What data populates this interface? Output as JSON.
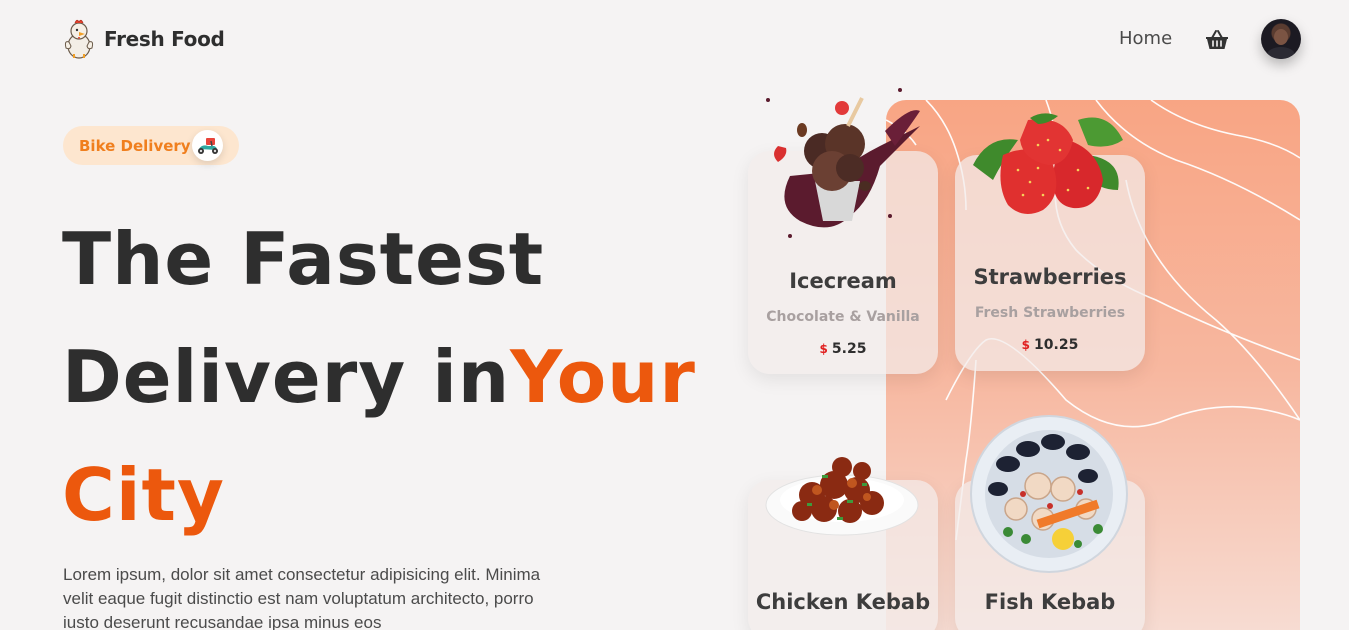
{
  "header": {
    "brand_name": "Fresh Food",
    "nav": {
      "home_label": "Home"
    },
    "icons": {
      "logo": "chicken-logo-icon",
      "cart": "basket-icon",
      "avatar": "user-avatar"
    }
  },
  "hero": {
    "badge_label": "Bike Delivery",
    "badge_icon": "scooter-icon",
    "headline_line1": "The Fastest",
    "headline_line2_plain": "Delivery in",
    "headline_line2_accent": "Your",
    "headline_line3_accent": "City",
    "description": "Lorem ipsum, dolor sit amet consectetur adipisicing elit. Minima velit eaque fugit distinctio est nam voluptatum architecto, porro iusto deserunt recusandae ipsa minus eos"
  },
  "cards": [
    {
      "title": "Icecream",
      "subtitle": "Chocolate & Vanilla",
      "currency": "$",
      "price": "5.25",
      "image": "icecream"
    },
    {
      "title": "Strawberries",
      "subtitle": "Fresh Strawberries",
      "currency": "$",
      "price": "10.25",
      "image": "strawberries"
    },
    {
      "title": "Chicken Kebab",
      "image": "chicken-kebab"
    },
    {
      "title": "Fish Kebab",
      "image": "fish-kebab"
    }
  ],
  "colors": {
    "accent": "#ec580d",
    "badge_bg": "#fde6cf",
    "badge_text": "#f07f1e",
    "panel": "#f8a584",
    "background": "#f5f3f3"
  }
}
